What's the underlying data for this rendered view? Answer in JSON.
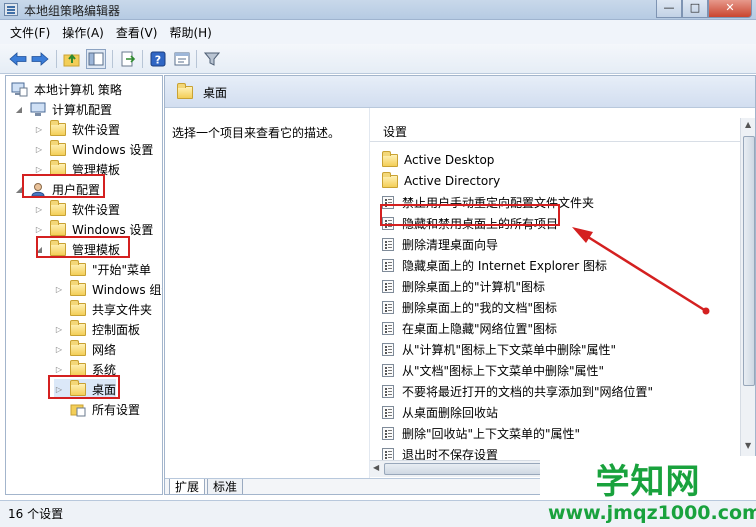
{
  "window": {
    "title": "本地组策略编辑器",
    "buttons": {
      "minimize": "—",
      "maximize": "□",
      "close": "✕"
    }
  },
  "menu": [
    "文件(F)",
    "操作(A)",
    "查看(V)",
    "帮助(H)"
  ],
  "toolbar": {
    "icons": [
      "back-arrow-icon",
      "forward-arrow-icon",
      "up-folder-icon",
      "show-hide-tree-icon",
      "export-list-icon",
      "help-icon",
      "properties-icon",
      "filter-icon"
    ]
  },
  "tree": {
    "root": "本地计算机 策略",
    "computer_config": "计算机配置",
    "cc_software": "软件设置",
    "cc_windows": "Windows 设置",
    "cc_admin": "管理模板",
    "user_config": "用户配置",
    "uc_software": "软件设置",
    "uc_windows": "Windows 设置",
    "uc_admin": "管理模板",
    "start_menu": "\"开始\"菜单",
    "windows_components": "Windows 组件",
    "shared_folders": "共享文件夹",
    "control_panel": "控制面板",
    "network": "网络",
    "system": "系统",
    "desktop": "桌面",
    "all_settings": "所有设置"
  },
  "right_pane": {
    "header_title": "桌面",
    "description": "选择一个项目来查看它的描述。",
    "column_header": "设置",
    "items": [
      {
        "type": "folder",
        "label": "Active Desktop"
      },
      {
        "type": "folder",
        "label": "Active Directory"
      },
      {
        "type": "policy",
        "label": "禁止用户手动重定向配置文件文件夹"
      },
      {
        "type": "policy",
        "label": "隐藏和禁用桌面上的所有项目"
      },
      {
        "type": "policy",
        "label": "删除清理桌面向导"
      },
      {
        "type": "policy",
        "label": "隐藏桌面上的 Internet Explorer 图标"
      },
      {
        "type": "policy",
        "label": "删除桌面上的\"计算机\"图标"
      },
      {
        "type": "policy",
        "label": "删除桌面上的\"我的文档\"图标"
      },
      {
        "type": "policy",
        "label": "在桌面上隐藏\"网络位置\"图标"
      },
      {
        "type": "policy",
        "label": "从\"计算机\"图标上下文菜单中删除\"属性\""
      },
      {
        "type": "policy",
        "label": "从\"文档\"图标上下文菜单中删除\"属性\""
      },
      {
        "type": "policy",
        "label": "不要将最近打开的文档的共享添加到\"网络位置\""
      },
      {
        "type": "policy",
        "label": "从桌面删除回收站"
      },
      {
        "type": "policy",
        "label": "删除\"回收站\"上下文菜单的\"属性\""
      },
      {
        "type": "policy",
        "label": "退出时不保存设置"
      }
    ],
    "tabs": [
      "扩展",
      "标准"
    ]
  },
  "status": {
    "text": "16 个设置"
  },
  "watermark": {
    "main": "学知网",
    "url": "www.jmqz1000.com"
  },
  "colors": {
    "highlight_red": "#d42020",
    "watermark_green": "#19a23d"
  }
}
